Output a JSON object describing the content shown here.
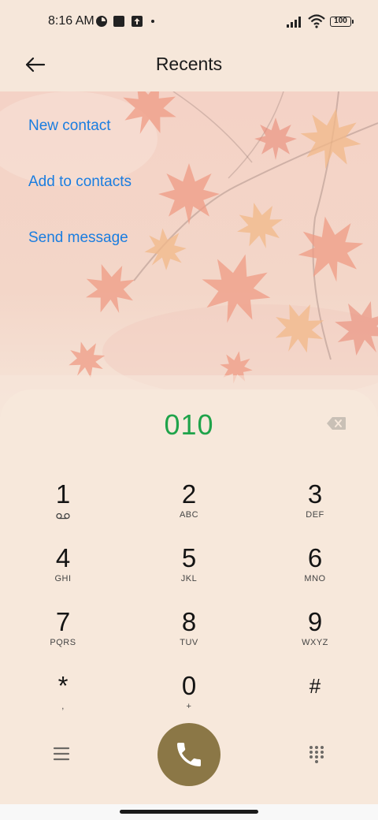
{
  "status_bar": {
    "time": "8:16 AM",
    "battery": "100",
    "icons": [
      "data-saver-icon",
      "app-notification-icon",
      "upload-icon",
      "signal-icon",
      "wifi-icon",
      "battery-icon"
    ]
  },
  "header": {
    "title": "Recents",
    "back_icon": "back-arrow-icon"
  },
  "actions": {
    "new_contact": "New contact",
    "add_to_contacts": "Add to contacts",
    "send_message": "Send message"
  },
  "dialer": {
    "number": "010",
    "keys": [
      {
        "digit": "1",
        "letters": ""
      },
      {
        "digit": "2",
        "letters": "ABC"
      },
      {
        "digit": "3",
        "letters": "DEF"
      },
      {
        "digit": "4",
        "letters": "GHI"
      },
      {
        "digit": "5",
        "letters": "JKL"
      },
      {
        "digit": "6",
        "letters": "MNO"
      },
      {
        "digit": "7",
        "letters": "PQRS"
      },
      {
        "digit": "8",
        "letters": "TUV"
      },
      {
        "digit": "9",
        "letters": "WXYZ"
      },
      {
        "digit": "*",
        "letters": ","
      },
      {
        "digit": "0",
        "letters": "+"
      },
      {
        "digit": "#",
        "letters": ""
      }
    ]
  },
  "colors": {
    "accent_link": "#1a7de0",
    "number_green": "#1fa34a",
    "call_button": "#8b7746",
    "background": "#f7e9dc"
  }
}
